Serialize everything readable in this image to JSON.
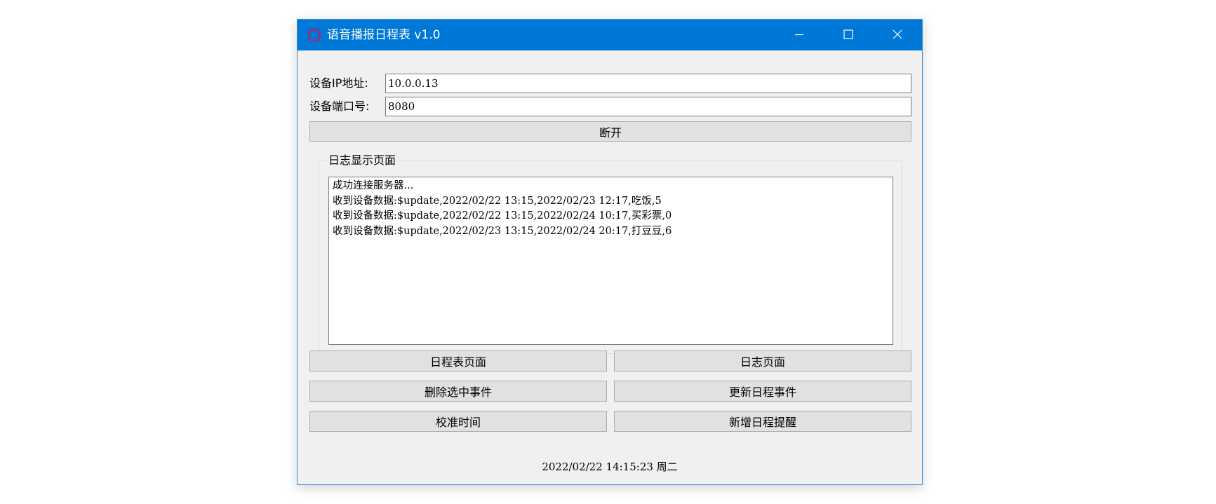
{
  "window": {
    "title": "语音播报日程表 v1.0",
    "icon": "gear-outline-icon",
    "controls": [
      "minimize-icon",
      "maximize-icon",
      "close-icon"
    ]
  },
  "connection": {
    "ip_label": "设备IP地址:",
    "ip_value": "10.0.0.13",
    "port_label": "设备端口号:",
    "port_value": "8080",
    "toggle_button": "断开"
  },
  "log": {
    "group_title": "日志显示页面",
    "lines": [
      "成功连接服务器...",
      "收到设备数据:$update,2022/02/22 13:15,2022/02/23 12:17,吃饭,5",
      "收到设备数据:$update,2022/02/22 13:15,2022/02/24 10:17,买彩票,0",
      "收到设备数据:$update,2022/02/23 13:15,2022/02/24 20:17,打豆豆,6"
    ]
  },
  "actions": {
    "schedule_page": "日程表页面",
    "log_page": "日志页面",
    "delete_selected": "删除选中事件",
    "update_schedule": "更新日程事件",
    "calibrate_time": "校准时间",
    "add_reminder": "新增日程提醒"
  },
  "status": {
    "datetime": "2022/02/22 14:15:23 周二"
  },
  "colors": {
    "titlebar": "#0078d7",
    "window_bg": "#f0f0f0",
    "button_bg": "#e1e1e1",
    "icon_accent": "#c2185b"
  }
}
